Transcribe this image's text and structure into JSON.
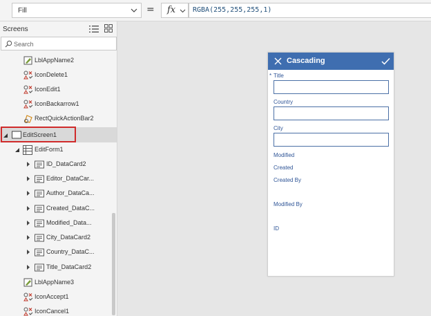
{
  "formula_bar": {
    "property": "Fill",
    "equals": "=",
    "fx_label": "fx",
    "formula": "RGBA(255,255,255,1)"
  },
  "left_panel": {
    "title": "Screens",
    "search_placeholder": "Search",
    "items": [
      {
        "label": "LblAppName2",
        "icon": "label-icon"
      },
      {
        "label": "IconDelete1",
        "icon": "icon-control-icon"
      },
      {
        "label": "IconEdit1",
        "icon": "icon-control-icon"
      },
      {
        "label": "IconBackarrow1",
        "icon": "icon-control-icon"
      },
      {
        "label": "RectQuickActionBar2",
        "icon": "shape-icon"
      },
      {
        "label": "EditScreen1",
        "icon": "screen-icon",
        "selected": true
      },
      {
        "label": "EditForm1",
        "icon": "form-icon"
      },
      {
        "label": "ID_DataCard2",
        "icon": "card-icon"
      },
      {
        "label": "Editor_DataCar...",
        "icon": "card-icon"
      },
      {
        "label": "Author_DataCa...",
        "icon": "card-icon"
      },
      {
        "label": "Created_DataC...",
        "icon": "card-icon"
      },
      {
        "label": "Modified_Data...",
        "icon": "card-icon"
      },
      {
        "label": "City_DataCard2",
        "icon": "card-icon"
      },
      {
        "label": "Country_DataC...",
        "icon": "card-icon"
      },
      {
        "label": "Title_DataCard2",
        "icon": "card-icon"
      },
      {
        "label": "LblAppName3",
        "icon": "label-icon"
      },
      {
        "label": "IconAccept1",
        "icon": "icon-control-icon"
      },
      {
        "label": "IconCancel1",
        "icon": "icon-control-icon"
      }
    ]
  },
  "preview": {
    "header_title": "Cascading",
    "header_color": "#3f6eb0",
    "required_marker": "*",
    "fields": {
      "title": "Title",
      "country": "Country",
      "city": "City",
      "modified": "Modified",
      "created": "Created",
      "created_by": "Created By",
      "modified_by": "Modified By",
      "id": "ID"
    }
  }
}
